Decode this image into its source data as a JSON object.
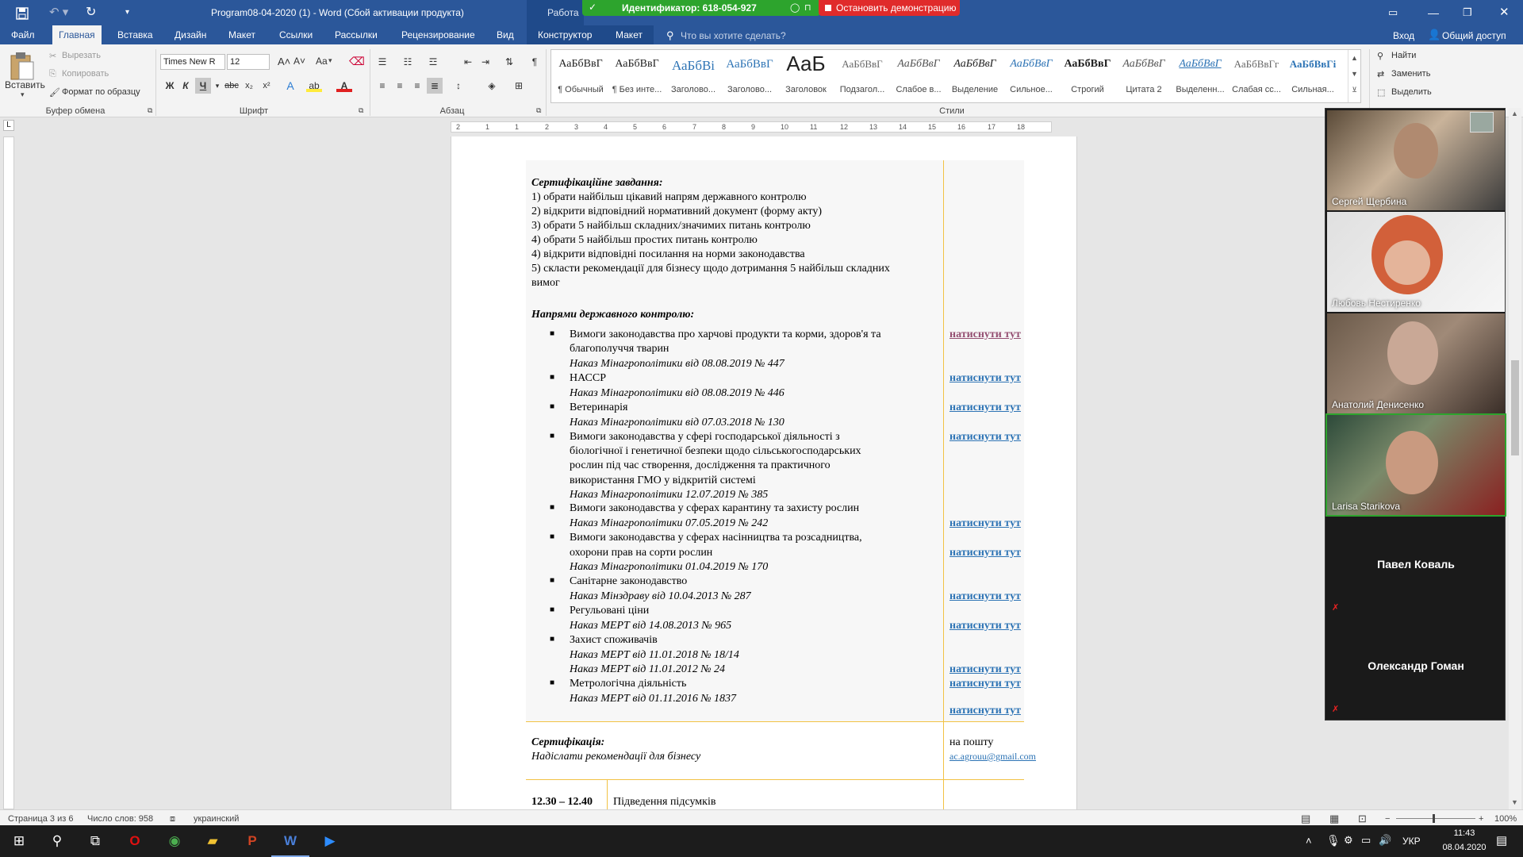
{
  "titlebar": {
    "doc_title": "Program08-04-2020 (1) - Word (Сбой активации продукта)",
    "context_title": "Работа с",
    "share_bar": {
      "id_text": "Идентификатор: 618-054-927",
      "stop_label": "Остановить демонстрацию"
    }
  },
  "tabs": {
    "items": [
      "Файл",
      "Главная",
      "Вставка",
      "Дизайн",
      "Макет",
      "Ссылки",
      "Рассылки",
      "Рецензирование",
      "Вид",
      "Конструктор",
      "Макет"
    ],
    "search_placeholder": "Что вы хотите сделать?",
    "signin": "Вход",
    "share": "Общий доступ"
  },
  "ribbon": {
    "clipboard": {
      "paste": "Вставить",
      "cut": "Вырезать",
      "copy": "Копировать",
      "format_painter": "Формат по образцу",
      "label": "Буфер обмена"
    },
    "font": {
      "family": "Times New R",
      "size": "12",
      "label": "Шрифт",
      "case_label": "Aa"
    },
    "paragraph": {
      "label": "Абзац"
    },
    "styles": {
      "label": "Стили",
      "items": [
        {
          "preview": "АаБбВвГ",
          "name": "¶ Обычный"
        },
        {
          "preview": "АаБбВвГ",
          "name": "¶ Без инте..."
        },
        {
          "preview": "АаБбВі",
          "name": "Заголово..."
        },
        {
          "preview": "АаБбВвГ",
          "name": "Заголово..."
        },
        {
          "preview": "АаБ",
          "name": "Заголовок"
        },
        {
          "preview": "АаБбВвГ",
          "name": "Подзагол..."
        },
        {
          "preview": "АаБбВвГ",
          "name": "Слабое в..."
        },
        {
          "preview": "АаБбВвГ",
          "name": "Выделение"
        },
        {
          "preview": "АаБбВвГ",
          "name": "Сильное..."
        },
        {
          "preview": "АаБбВвГ",
          "name": "Строгий"
        },
        {
          "preview": "АаБбВвГ",
          "name": "Цитата 2"
        },
        {
          "preview": "АаБбВвГ",
          "name": "Выделенн..."
        },
        {
          "preview": "АаБбВвГг",
          "name": "Слабая сс..."
        },
        {
          "preview": "АаБбВвГі",
          "name": "Сильная..."
        }
      ]
    },
    "editing": {
      "find": "Найти",
      "replace": "Заменить",
      "select": "Выделить"
    }
  },
  "ruler": {
    "h_marks": [
      "2",
      "1",
      "1",
      "2",
      "3",
      "4",
      "5",
      "6",
      "7",
      "8",
      "9",
      "10",
      "11",
      "12",
      "13",
      "14",
      "15",
      "16",
      "17",
      "18"
    ]
  },
  "document": {
    "cert_task_title": "Сертифікаційне завдання:",
    "cert_task_items": [
      "1) обрати найбільш цікавий напрям державного контролю",
      "2) відкрити відповідний нормативний документ (форму акту)",
      "3) обрати 5 найбільш складних/значимих питань контролю",
      "4) обрати 5 найбільш простих питань контролю",
      "4) відкрити відповідні посилання на норми законодавства",
      "5) скласти рекомендації для бізнесу щодо дотримання 5 найбільш складних",
      "вимог"
    ],
    "directions_title": "Напрями державного контролю:",
    "lines": [
      {
        "text": "Вимоги законодавства про харчові продукти та корми, здоров'я та",
        "italic": false,
        "bullet": true
      },
      {
        "text": "благополуччя тварин",
        "italic": false
      },
      {
        "text": "Наказ Мінагрополітики від 08.08.2019 № 447",
        "italic": true
      },
      {
        "text": "НАССР",
        "italic": false,
        "bullet": true
      },
      {
        "text": "Наказ Мінагрополітики від 08.08.2019 № 446",
        "italic": true
      },
      {
        "text": "Ветеринарія",
        "italic": false,
        "bullet": true
      },
      {
        "text": "Наказ Мінагрополітики від 07.03.2018 № 130",
        "italic": true
      },
      {
        "text": "Вимоги законодавства у сфері господарської діяльності з",
        "italic": false,
        "bullet": true
      },
      {
        "text": "біологічної і генетичної безпеки щодо сільськогосподарських",
        "italic": false
      },
      {
        "text": "рослин під час створення, дослідження та практичного",
        "italic": false
      },
      {
        "text": "використання ГМО у відкритій системі",
        "italic": false
      },
      {
        "text": "Наказ Мінагрополітики 12.07.2019  № 385",
        "italic": true
      },
      {
        "text": "Вимоги законодавства у сферах карантину та захисту рослин",
        "italic": false,
        "bullet": true
      },
      {
        "text": "Наказ Мінагрополітики 07.05.2019 № 242",
        "italic": true
      },
      {
        "text": "Вимоги законодавства у сферах насінництва та розсадництва,",
        "italic": false,
        "bullet": true
      },
      {
        "text": "охорони прав на сорти рослин",
        "italic": false
      },
      {
        "text": "Наказ Мінагрополітики 01.04.2019  № 170",
        "italic": true
      },
      {
        "text": "Санітарне законодавство",
        "italic": false,
        "bullet": true
      },
      {
        "text": "Наказ Мінздраву від 10.04.2013  № 287",
        "italic": true
      },
      {
        "text": "Регульовані ціни",
        "italic": false,
        "bullet": true
      },
      {
        "text": "Наказ МЕРТ від 14.08.2013  № 965",
        "italic": true
      },
      {
        "text": "Захист споживачів",
        "italic": false,
        "bullet": true
      },
      {
        "text": "Наказ МЕРТ від 11.01.2018 № 18/14",
        "italic": true
      },
      {
        "text": "Наказ МЕРТ від 11.01.2012  № 24",
        "italic": true
      },
      {
        "text": "Метрологічна діяльність",
        "italic": false,
        "bullet": true
      },
      {
        "text": "Наказ МЕРТ від 01.11.2016 № 1837",
        "italic": true
      }
    ],
    "link_text": "натиснути тут",
    "cert_title": "Сертифікація:",
    "cert_sub": "Надіслати рекомендації для бізнесу",
    "mail_label": "на пошту",
    "mail": "ac.agrouu@gmail.com",
    "time": "12.30 – 12.40",
    "summary": "Підведення підсумків"
  },
  "statusbar": {
    "page": "Страница 3 из 6",
    "words": "Число слов: 958",
    "lang": "украинский",
    "zoom": "100%"
  },
  "taskbar": {
    "time": "11:43",
    "date": "08.04.2020",
    "lang": "УКР"
  },
  "zoom_panel": {
    "participants": [
      {
        "name": "Сергей Щербина"
      },
      {
        "name": "Любовь Нестиренко"
      },
      {
        "name": "Анатолий Денисенко"
      },
      {
        "name": "Larisa Starikova"
      },
      {
        "name": "Павел Коваль"
      },
      {
        "name": "Олександр Гоман"
      }
    ]
  },
  "colors": {
    "word_blue": "#2b579a",
    "zoom_green": "#2da42d",
    "stop_red": "#e02b2b",
    "link": "#2e74b5",
    "table_border": "#f2c244"
  }
}
